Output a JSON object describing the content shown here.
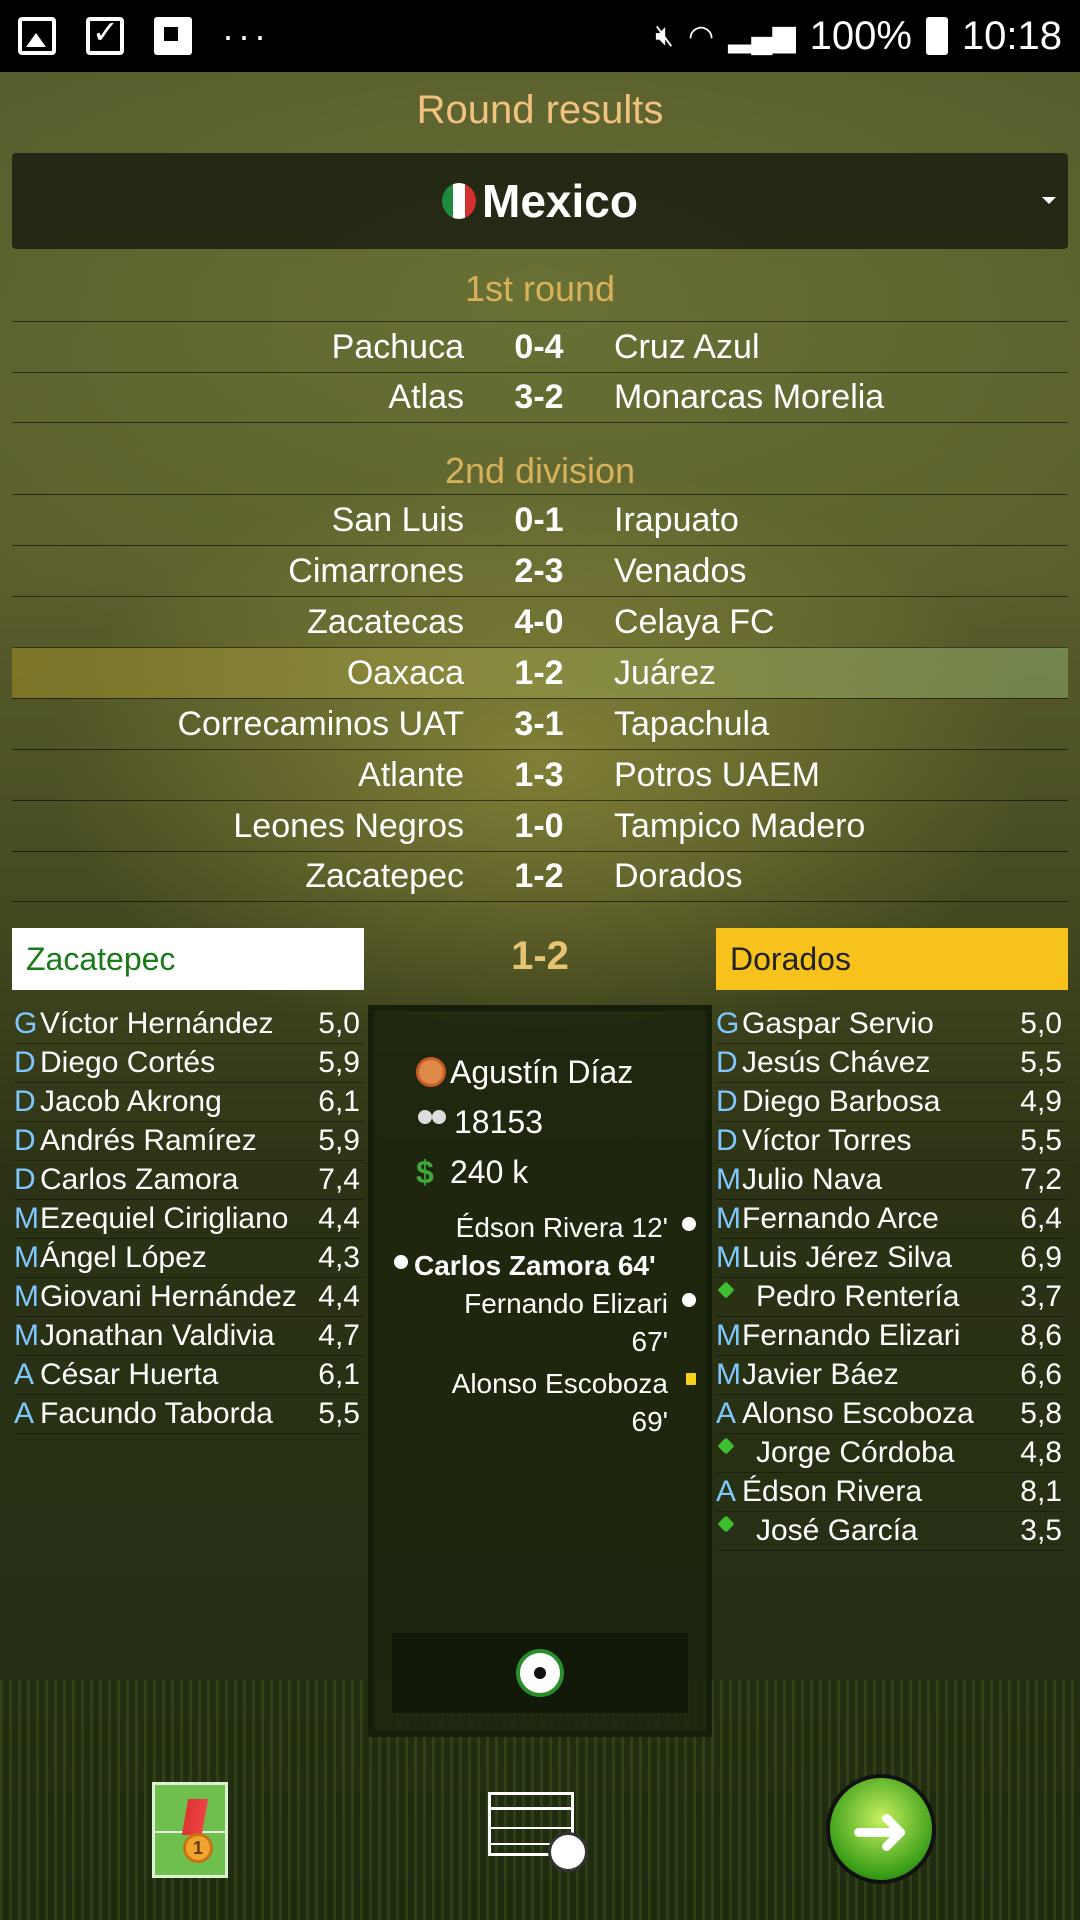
{
  "status_bar": {
    "battery": "100%",
    "time": "10:18",
    "dots": "···"
  },
  "title": "Round results",
  "country": {
    "name": "Mexico",
    "flag_colors": [
      "#1f8a3d",
      "#ffffff",
      "#d32f2f"
    ]
  },
  "sections": [
    {
      "title": "1st round",
      "matches": [
        {
          "home": "Pachuca",
          "score": "0-4",
          "away": "Cruz Azul"
        },
        {
          "home": "Atlas",
          "score": "3-2",
          "away": "Monarcas Morelia"
        }
      ]
    },
    {
      "title": "2nd division",
      "matches": [
        {
          "home": "San Luis",
          "score": "0-1",
          "away": "Irapuato"
        },
        {
          "home": "Cimarrones",
          "score": "2-3",
          "away": "Venados"
        },
        {
          "home": "Zacatecas",
          "score": "4-0",
          "away": "Celaya FC"
        },
        {
          "home": "Oaxaca",
          "score": "1-2",
          "away": "Juárez"
        },
        {
          "home": "Correcaminos UAT",
          "score": "3-1",
          "away": "Tapachula"
        },
        {
          "home": "Atlante",
          "score": "1-3",
          "away": "Potros UAEM"
        },
        {
          "home": "Leones Negros",
          "score": "1-0",
          "away": "Tampico Madero"
        },
        {
          "home": "Zacatepec",
          "score": "1-2",
          "away": "Dorados"
        }
      ]
    }
  ],
  "detail": {
    "home_team": "Zacatepec",
    "away_team": "Dorados",
    "score": "1-2",
    "referee": "Agustín Díaz",
    "attendance": "18153",
    "income": "240 k",
    "events": [
      {
        "text": "Édson Rivera 12'",
        "side": "away",
        "type": "goal"
      },
      {
        "text": "Carlos Zamora 64'",
        "side": "home",
        "type": "goal"
      },
      {
        "text": "Fernando Elizari 67'",
        "side": "away",
        "type": "goal"
      },
      {
        "text": "Alonso Escoboza 69'",
        "side": "away",
        "type": "yellow"
      }
    ],
    "home_lineup": [
      {
        "pos": "G",
        "name": "Víctor Hernández",
        "rating": "5,0"
      },
      {
        "pos": "D",
        "name": "Diego Cortés",
        "rating": "5,9"
      },
      {
        "pos": "D",
        "name": "Jacob Akrong",
        "rating": "6,1"
      },
      {
        "pos": "D",
        "name": "Andrés Ramírez",
        "rating": "5,9"
      },
      {
        "pos": "D",
        "name": "Carlos Zamora",
        "rating": "7,4"
      },
      {
        "pos": "M",
        "name": "Ezequiel Cirigliano",
        "rating": "4,4"
      },
      {
        "pos": "M",
        "name": "Ángel López",
        "rating": "4,3"
      },
      {
        "pos": "M",
        "name": "Giovani Hernández",
        "rating": "4,4"
      },
      {
        "pos": "M",
        "name": "Jonathan Valdivia",
        "rating": "4,7"
      },
      {
        "pos": "A",
        "name": "César Huerta",
        "rating": "6,1"
      },
      {
        "pos": "A",
        "name": "Facundo Taborda",
        "rating": "5,5"
      }
    ],
    "away_lineup": [
      {
        "pos": "G",
        "name": "Gaspar Servio",
        "rating": "5,0"
      },
      {
        "pos": "D",
        "name": "Jesús Chávez",
        "rating": "5,5"
      },
      {
        "pos": "D",
        "name": "Diego Barbosa",
        "rating": "4,9"
      },
      {
        "pos": "D",
        "name": "Víctor Torres",
        "rating": "5,5"
      },
      {
        "pos": "M",
        "name": "Julio Nava",
        "rating": "7,2"
      },
      {
        "pos": "M",
        "name": "Fernando Arce",
        "rating": "6,4"
      },
      {
        "pos": "M",
        "name": "Luis Jérez Silva",
        "rating": "6,9"
      },
      {
        "pos": "",
        "name": "Pedro Rentería",
        "rating": "3,7",
        "sub": true
      },
      {
        "pos": "M",
        "name": "Fernando Elizari",
        "rating": "8,6"
      },
      {
        "pos": "M",
        "name": "Javier Báez",
        "rating": "6,6"
      },
      {
        "pos": "A",
        "name": "Alonso Escoboza",
        "rating": "5,8"
      },
      {
        "pos": "",
        "name": "Jorge Córdoba",
        "rating": "4,8",
        "sub": true
      },
      {
        "pos": "A",
        "name": "Édson Rivera",
        "rating": "8,1"
      },
      {
        "pos": "",
        "name": "José García",
        "rating": "3,5",
        "sub": true
      }
    ]
  },
  "bottom_bar": {
    "medal_number": "1",
    "icons": [
      "field-medal-icon",
      "league-table-icon",
      "next-arrow-icon"
    ]
  }
}
